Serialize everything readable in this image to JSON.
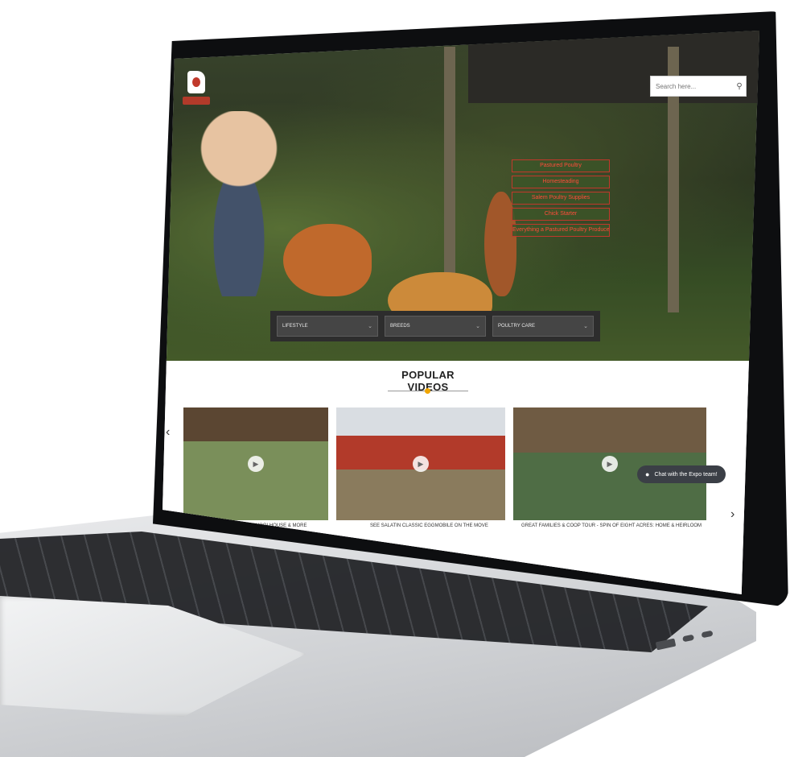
{
  "search": {
    "placeholder": "Search here...",
    "icon": "search-icon"
  },
  "hero_menu": [
    "Pastured Poultry",
    "Homesteading",
    "Salem Poultry Supplies",
    "Chick Starter",
    "Everything a Pastured Poultry Producer..."
  ],
  "filters": [
    {
      "label": "LIFESTYLE"
    },
    {
      "label": "BREEDS"
    },
    {
      "label": "POULTRY CARE"
    }
  ],
  "popular": {
    "title": "POPULAR VIDEOS"
  },
  "videos": [
    {
      "caption": "INSIDE THE SALATIN SCHOOLHOUSE & MORE"
    },
    {
      "caption": "SEE SALATIN CLASSIC EGGMOBILE ON THE MOVE"
    },
    {
      "caption": "GREAT FAMILIES & COOP TOUR - SPIN OF EIGHT ACRES: HOME & HEIRLOOM"
    }
  ],
  "carousel": {
    "prev_icon": "chevron-left-icon",
    "next_icon": "chevron-right-icon"
  },
  "chat": {
    "label": "Chat with the Expo team!",
    "icon": "chat-icon"
  },
  "colors": {
    "accent_red": "#c0392b",
    "accent_gold": "#f0a500",
    "menu_bg": "#3c5528",
    "filter_bar": "#2d2d2d"
  }
}
